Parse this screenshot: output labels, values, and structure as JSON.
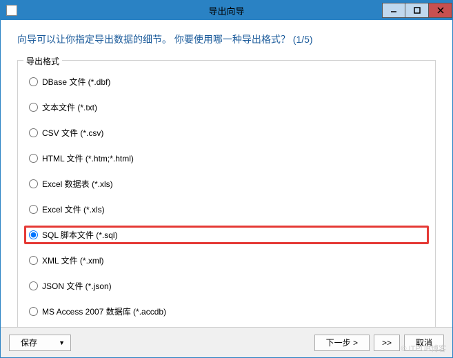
{
  "window": {
    "title": "导出向导"
  },
  "header": {
    "text": "向导可以让你指定导出数据的细节。 你要使用哪一种导出格式？ (1/5)"
  },
  "fieldset": {
    "legend": "导出格式"
  },
  "formats": [
    {
      "label": "DBase 文件 (*.dbf)",
      "selected": false
    },
    {
      "label": "文本文件 (*.txt)",
      "selected": false
    },
    {
      "label": "CSV 文件 (*.csv)",
      "selected": false
    },
    {
      "label": "HTML 文件 (*.htm;*.html)",
      "selected": false
    },
    {
      "label": "Excel 数据表 (*.xls)",
      "selected": false
    },
    {
      "label": "Excel 文件 (*.xls)",
      "selected": false
    },
    {
      "label": "SQL 脚本文件 (*.sql)",
      "selected": true
    },
    {
      "label": "XML 文件 (*.xml)",
      "selected": false
    },
    {
      "label": "JSON 文件 (*.json)",
      "selected": false
    },
    {
      "label": "MS Access 2007 数据库 (*.accdb)",
      "selected": false
    }
  ],
  "footer": {
    "save": "保存",
    "next": "下一步 >",
    "skip": ">>",
    "cancel": "取消"
  },
  "watermark": "© ITPUB博客"
}
